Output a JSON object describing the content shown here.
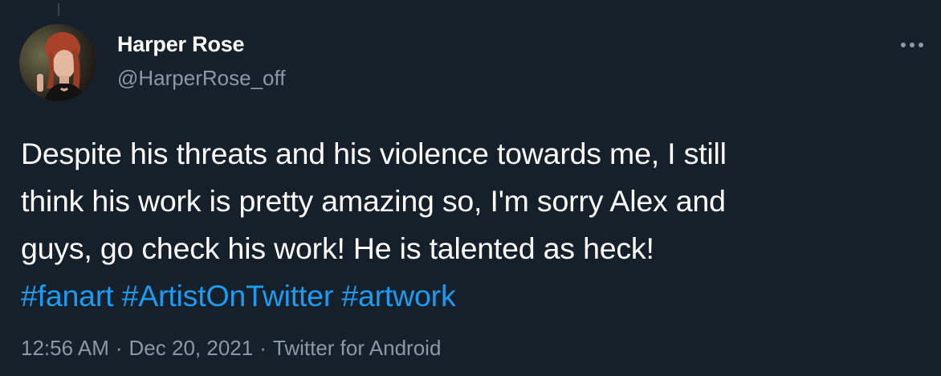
{
  "author": {
    "display_name": "Harper Rose",
    "handle": "@HarperRose_off"
  },
  "tweet": {
    "lines": [
      "Despite his threats and his violence towards me, I still",
      "think his work is pretty amazing so, I'm sorry Alex and",
      "guys, go check his work! He is talented as heck!"
    ],
    "hashtags": [
      "#fanart",
      "#ArtistOnTwitter",
      "#artwork"
    ]
  },
  "meta": {
    "time": "12:56 AM",
    "separator": "·",
    "date": "Dec 20, 2021",
    "source": "Twitter for Android"
  },
  "icons": {
    "more": "more-horizontal-icon"
  },
  "colors": {
    "background": "#15202b",
    "text": "#ffffff",
    "secondary": "#8b98a5",
    "link": "#1d9bf0"
  }
}
